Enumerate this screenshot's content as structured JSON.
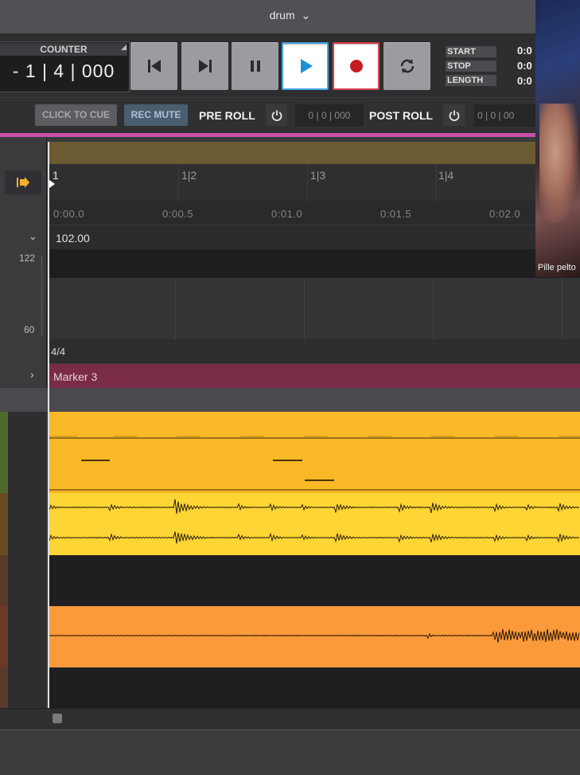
{
  "window": {
    "title": "drum",
    "title_chevron_icon": "chevron-down-icon"
  },
  "counter": {
    "label": "COUNTER",
    "value": "- 1 | 4 | 000"
  },
  "transport": {
    "buttons": [
      "rewind-to-start",
      "skip-forward",
      "pause",
      "play",
      "record",
      "loop"
    ],
    "colors": {
      "play": "#43a6e2",
      "record": "#d6414a"
    }
  },
  "selection": {
    "start_label": "START",
    "stop_label": "STOP",
    "length_label": "LENGTH",
    "start_value": "0:0",
    "stop_value": "0:0",
    "length_value": "0:0"
  },
  "controls": {
    "click_to_cue": "CLICK TO CUE",
    "rec_mute": "REC MUTE",
    "pre_roll_label": "PRE ROLL",
    "pre_roll_value": "0 | 0 | 000",
    "post_roll_label": "POST ROLL",
    "post_roll_value": "0 | 0 | 00"
  },
  "timeline": {
    "bars": [
      "1",
      "1|2",
      "1|3",
      "1|4"
    ],
    "seconds": [
      "0:00.0",
      "0:00.5",
      "0:01.0",
      "0:01.5",
      "0:02.0"
    ],
    "tempo_value": "102.00",
    "tempo_max": "122",
    "tempo_min": "60",
    "time_signature": "4/4",
    "marker_name": "Marker 3",
    "colors": {
      "marker": "#7a2b48",
      "accent_pink": "#c94fa8"
    }
  },
  "tracks": [
    {
      "type": "midi",
      "color": "#f9b826"
    },
    {
      "type": "audio",
      "color": "#fdd535"
    },
    {
      "type": "empty"
    },
    {
      "type": "audio",
      "color": "#fb9a3a"
    },
    {
      "type": "empty"
    }
  ],
  "webcam": {
    "caption": "Pille pelto"
  }
}
